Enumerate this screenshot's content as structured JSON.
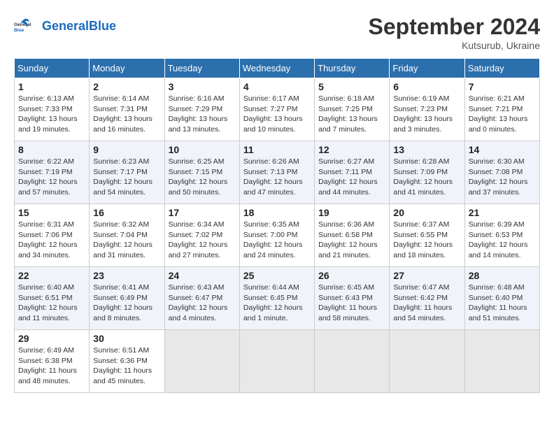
{
  "header": {
    "logo_general": "General",
    "logo_blue": "Blue",
    "month_title": "September 2024",
    "subtitle": "Kutsurub, Ukraine"
  },
  "weekdays": [
    "Sunday",
    "Monday",
    "Tuesday",
    "Wednesday",
    "Thursday",
    "Friday",
    "Saturday"
  ],
  "weeks": [
    [
      {
        "day": "1",
        "info": "Sunrise: 6:13 AM\nSunset: 7:33 PM\nDaylight: 13 hours and 19 minutes."
      },
      {
        "day": "2",
        "info": "Sunrise: 6:14 AM\nSunset: 7:31 PM\nDaylight: 13 hours and 16 minutes."
      },
      {
        "day": "3",
        "info": "Sunrise: 6:16 AM\nSunset: 7:29 PM\nDaylight: 13 hours and 13 minutes."
      },
      {
        "day": "4",
        "info": "Sunrise: 6:17 AM\nSunset: 7:27 PM\nDaylight: 13 hours and 10 minutes."
      },
      {
        "day": "5",
        "info": "Sunrise: 6:18 AM\nSunset: 7:25 PM\nDaylight: 13 hours and 7 minutes."
      },
      {
        "day": "6",
        "info": "Sunrise: 6:19 AM\nSunset: 7:23 PM\nDaylight: 13 hours and 3 minutes."
      },
      {
        "day": "7",
        "info": "Sunrise: 6:21 AM\nSunset: 7:21 PM\nDaylight: 13 hours and 0 minutes."
      }
    ],
    [
      {
        "day": "8",
        "info": "Sunrise: 6:22 AM\nSunset: 7:19 PM\nDaylight: 12 hours and 57 minutes."
      },
      {
        "day": "9",
        "info": "Sunrise: 6:23 AM\nSunset: 7:17 PM\nDaylight: 12 hours and 54 minutes."
      },
      {
        "day": "10",
        "info": "Sunrise: 6:25 AM\nSunset: 7:15 PM\nDaylight: 12 hours and 50 minutes."
      },
      {
        "day": "11",
        "info": "Sunrise: 6:26 AM\nSunset: 7:13 PM\nDaylight: 12 hours and 47 minutes."
      },
      {
        "day": "12",
        "info": "Sunrise: 6:27 AM\nSunset: 7:11 PM\nDaylight: 12 hours and 44 minutes."
      },
      {
        "day": "13",
        "info": "Sunrise: 6:28 AM\nSunset: 7:09 PM\nDaylight: 12 hours and 41 minutes."
      },
      {
        "day": "14",
        "info": "Sunrise: 6:30 AM\nSunset: 7:08 PM\nDaylight: 12 hours and 37 minutes."
      }
    ],
    [
      {
        "day": "15",
        "info": "Sunrise: 6:31 AM\nSunset: 7:06 PM\nDaylight: 12 hours and 34 minutes."
      },
      {
        "day": "16",
        "info": "Sunrise: 6:32 AM\nSunset: 7:04 PM\nDaylight: 12 hours and 31 minutes."
      },
      {
        "day": "17",
        "info": "Sunrise: 6:34 AM\nSunset: 7:02 PM\nDaylight: 12 hours and 27 minutes."
      },
      {
        "day": "18",
        "info": "Sunrise: 6:35 AM\nSunset: 7:00 PM\nDaylight: 12 hours and 24 minutes."
      },
      {
        "day": "19",
        "info": "Sunrise: 6:36 AM\nSunset: 6:58 PM\nDaylight: 12 hours and 21 minutes."
      },
      {
        "day": "20",
        "info": "Sunrise: 6:37 AM\nSunset: 6:55 PM\nDaylight: 12 hours and 18 minutes."
      },
      {
        "day": "21",
        "info": "Sunrise: 6:39 AM\nSunset: 6:53 PM\nDaylight: 12 hours and 14 minutes."
      }
    ],
    [
      {
        "day": "22",
        "info": "Sunrise: 6:40 AM\nSunset: 6:51 PM\nDaylight: 12 hours and 11 minutes."
      },
      {
        "day": "23",
        "info": "Sunrise: 6:41 AM\nSunset: 6:49 PM\nDaylight: 12 hours and 8 minutes."
      },
      {
        "day": "24",
        "info": "Sunrise: 6:43 AM\nSunset: 6:47 PM\nDaylight: 12 hours and 4 minutes."
      },
      {
        "day": "25",
        "info": "Sunrise: 6:44 AM\nSunset: 6:45 PM\nDaylight: 12 hours and 1 minute."
      },
      {
        "day": "26",
        "info": "Sunrise: 6:45 AM\nSunset: 6:43 PM\nDaylight: 11 hours and 58 minutes."
      },
      {
        "day": "27",
        "info": "Sunrise: 6:47 AM\nSunset: 6:42 PM\nDaylight: 11 hours and 54 minutes."
      },
      {
        "day": "28",
        "info": "Sunrise: 6:48 AM\nSunset: 6:40 PM\nDaylight: 11 hours and 51 minutes."
      }
    ],
    [
      {
        "day": "29",
        "info": "Sunrise: 6:49 AM\nSunset: 6:38 PM\nDaylight: 11 hours and 48 minutes."
      },
      {
        "day": "30",
        "info": "Sunrise: 6:51 AM\nSunset: 6:36 PM\nDaylight: 11 hours and 45 minutes."
      },
      null,
      null,
      null,
      null,
      null
    ]
  ]
}
